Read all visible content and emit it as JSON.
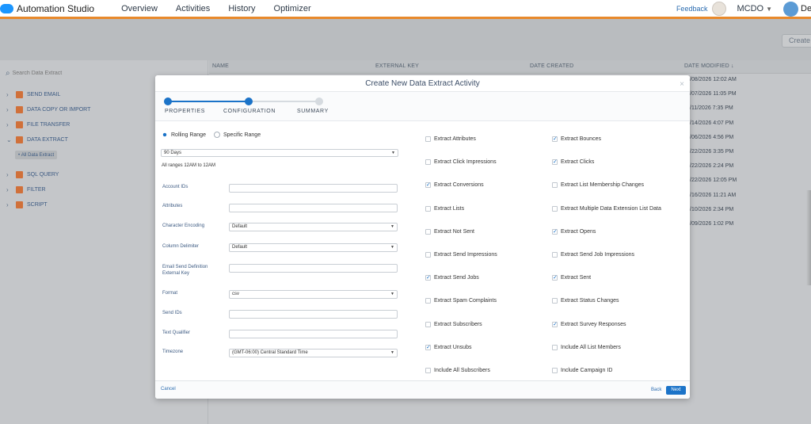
{
  "app": {
    "name": "Automation Studio"
  },
  "nav": {
    "items": [
      "Overview",
      "Activities",
      "History",
      "Optimizer"
    ]
  },
  "topright": {
    "feedback": "Feedback",
    "business_unit": "MCDO",
    "user": "Den"
  },
  "header": {
    "create_button": "Create A"
  },
  "sidebar": {
    "search_placeholder": "Search Data Extract",
    "items": [
      {
        "label": "SEND EMAIL",
        "expanded": false
      },
      {
        "label": "DATA COPY OR IMPORT",
        "expanded": false
      },
      {
        "label": "FILE TRANSFER",
        "expanded": false
      },
      {
        "label": "DATA EXTRACT",
        "expanded": true
      },
      {
        "label": "SQL QUERY",
        "expanded": false
      },
      {
        "label": "FILTER",
        "expanded": false
      },
      {
        "label": "SCRIPT",
        "expanded": false
      }
    ],
    "sub_item": "All Data Extract"
  },
  "table": {
    "headers": {
      "name": "NAME",
      "external_key": "EXTERNAL KEY",
      "date_created": "DATE CREATED",
      "date_modified": "DATE MODIFIED ↓"
    },
    "date_modified": [
      "/08/2026 12:02 AM",
      "/07/2026 11:05 PM",
      "/11/2026 7:35 PM",
      "/14/2026 4:07 PM",
      "/06/2026 4:56 PM",
      "/22/2026 3:35 PM",
      "/22/2026 2:24 PM",
      "/22/2026 12:05 PM",
      "/16/2026 11:21 AM",
      "/10/2026 2:34 PM",
      "/09/2026 1:02 PM"
    ]
  },
  "modal": {
    "title": "Create New Data Extract Activity",
    "close": "×",
    "steps": [
      {
        "label": "PROPERTIES",
        "state": "done"
      },
      {
        "label": "CONFIGURATION",
        "state": "current"
      },
      {
        "label": "SUMMARY",
        "state": "pending"
      }
    ],
    "range": {
      "rolling": "Rolling Range",
      "specific": "Specific Range",
      "selected": "rolling",
      "value": "90 Days",
      "note": "All ranges 12AM to 12AM"
    },
    "fields": {
      "account_ids": {
        "label": "Account IDs",
        "value": ""
      },
      "attributes": {
        "label": "Attributes",
        "value": ""
      },
      "character_encoding": {
        "label": "Character Encoding",
        "value": "Default"
      },
      "column_delimiter": {
        "label": "Column Delimiter",
        "value": "Default"
      },
      "email_send_def_line1": {
        "label": "Email Send Definition"
      },
      "email_send_def_line2": {
        "label": "External Key",
        "value": ""
      },
      "format": {
        "label": "Format",
        "value": "csv"
      },
      "send_ids": {
        "label": "Send IDs",
        "value": ""
      },
      "text_qualifier": {
        "label": "Text Qualifier",
        "value": ""
      },
      "timezone": {
        "label": "Timezone",
        "value": "(GMT-06:00) Central Standard Time"
      }
    },
    "checkboxes_left": [
      {
        "label": "Extract Attributes",
        "checked": false
      },
      {
        "label": "Extract Click Impressions",
        "checked": false
      },
      {
        "label": "Extract Conversions",
        "checked": true
      },
      {
        "label": "Extract Lists",
        "checked": false
      },
      {
        "label": "Extract Not Sent",
        "checked": false
      },
      {
        "label": "Extract Send Impressions",
        "checked": false
      },
      {
        "label": "Extract Send Jobs",
        "checked": true
      },
      {
        "label": "Extract Spam Complaints",
        "checked": false
      },
      {
        "label": "Extract Subscribers",
        "checked": false
      },
      {
        "label": "Extract Unsubs",
        "checked": true
      },
      {
        "label": "Include All Subscribers",
        "checked": false
      }
    ],
    "checkboxes_right": [
      {
        "label": "Extract Bounces",
        "checked": true
      },
      {
        "label": "Extract Clicks",
        "checked": true
      },
      {
        "label": "Extract List Membership Changes",
        "checked": false
      },
      {
        "label": "Extract Multiple Data Extension List Data",
        "checked": false
      },
      {
        "label": "Extract Opens",
        "checked": true
      },
      {
        "label": "Extract Send Job Impressions",
        "checked": false
      },
      {
        "label": "Extract Sent",
        "checked": true
      },
      {
        "label": "Extract Status Changes",
        "checked": false
      },
      {
        "label": "Extract Survey Responses",
        "checked": true
      },
      {
        "label": "Include All List Members",
        "checked": false
      },
      {
        "label": "Include Campaign ID",
        "checked": false
      }
    ],
    "footer": {
      "cancel": "Cancel",
      "back": "Back",
      "next": "Next"
    }
  },
  "colors": {
    "accent": "#e8892b",
    "primary": "#1b73c8",
    "link": "#2b6cb0"
  }
}
